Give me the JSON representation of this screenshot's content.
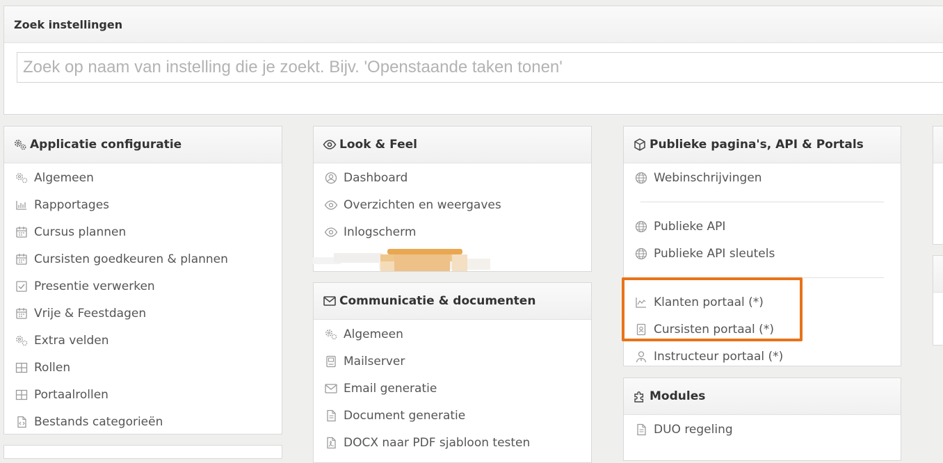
{
  "search": {
    "title": "Zoek instellingen",
    "placeholder": "Zoek op naam van instelling die je zoekt. Bijv. 'Openstaande taken tonen'",
    "value": ""
  },
  "applicatie": {
    "title": "Applicatie configuratie",
    "icon": "gears-icon",
    "items": [
      {
        "label": "Algemeen",
        "icon": "gears-icon"
      },
      {
        "label": "Rapportages",
        "icon": "bar-chart-icon"
      },
      {
        "label": "Cursus plannen",
        "icon": "calendar-icon"
      },
      {
        "label": "Cursisten goedkeuren & plannen",
        "icon": "calendar-icon"
      },
      {
        "label": "Presentie verwerken",
        "icon": "checkbox-icon"
      },
      {
        "label": "Vrije & Feestdagen",
        "icon": "calendar-icon"
      },
      {
        "label": "Extra velden",
        "icon": "gears-icon"
      },
      {
        "label": "Rollen",
        "icon": "grid-icon"
      },
      {
        "label": "Portaalrollen",
        "icon": "grid-icon"
      },
      {
        "label": "Bestands categorieën",
        "icon": "file-code-icon"
      }
    ]
  },
  "look": {
    "title": "Look & Feel",
    "icon": "eye-icon",
    "items": [
      {
        "label": "Dashboard",
        "icon": "user-circle-icon"
      },
      {
        "label": "Overzichten en weergaves",
        "icon": "eye-icon"
      },
      {
        "label": "Inlogscherm",
        "icon": "eye-icon"
      }
    ]
  },
  "communicatie": {
    "title": "Communicatie & documenten",
    "icon": "envelope-icon",
    "items": [
      {
        "label": "Algemeen",
        "icon": "gears-icon"
      },
      {
        "label": "Mailserver",
        "icon": "server-icon"
      },
      {
        "label": "Email generatie",
        "icon": "envelope-icon"
      },
      {
        "label": "Document generatie",
        "icon": "document-icon"
      },
      {
        "label": "DOCX naar PDF sjabloon testen",
        "icon": "pdf-icon"
      }
    ]
  },
  "publiek": {
    "title": "Publieke pagina's, API & Portals",
    "icon": "cube-icon",
    "group1": [
      {
        "label": "Webinschrijvingen",
        "icon": "globe-icon"
      }
    ],
    "group2": [
      {
        "label": "Publieke API",
        "icon": "globe-icon"
      },
      {
        "label": "Publieke API sleutels",
        "icon": "globe-icon"
      }
    ],
    "group3": [
      {
        "label": "Klanten portaal (*)",
        "icon": "line-chart-icon"
      },
      {
        "label": "Cursisten portaal (*)",
        "icon": "id-badge-icon"
      },
      {
        "label": "Instructeur portaal (*)",
        "icon": "user-tie-icon"
      }
    ]
  },
  "modules": {
    "title": "Modules",
    "icon": "puzzle-icon",
    "items": [
      {
        "label": "DUO regeling",
        "icon": "document-icon"
      }
    ]
  },
  "colors": {
    "highlight": "#e8731a",
    "blur_orange": "#eaa752"
  }
}
